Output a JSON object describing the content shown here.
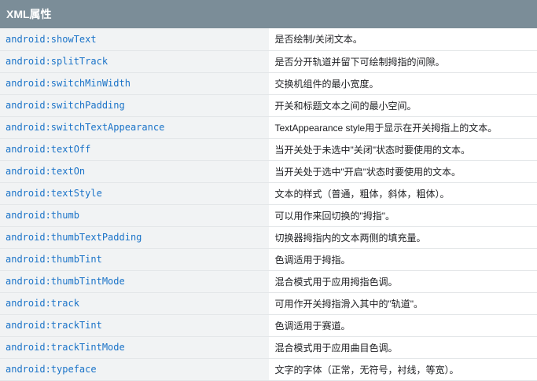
{
  "table": {
    "header": "XML属性",
    "rows": [
      {
        "attr": "android:showText",
        "desc": "是否绘制/关闭文本。"
      },
      {
        "attr": "android:splitTrack",
        "desc": "是否分开轨道并留下可绘制拇指的间隙。"
      },
      {
        "attr": "android:switchMinWidth",
        "desc": "交换机组件的最小宽度。"
      },
      {
        "attr": "android:switchPadding",
        "desc": "开关和标题文本之间的最小空间。"
      },
      {
        "attr": "android:switchTextAppearance",
        "desc": "TextAppearance style用于显示在开关拇指上的文本。"
      },
      {
        "attr": "android:textOff",
        "desc": "当开关处于未选中\"关闭\"状态时要使用的文本。"
      },
      {
        "attr": "android:textOn",
        "desc": "当开关处于选中\"开启\"状态时要使用的文本。"
      },
      {
        "attr": "android:textStyle",
        "desc": "文本的样式（普通，粗体，斜体，粗体）。"
      },
      {
        "attr": "android:thumb",
        "desc": "可以用作来回切换的\"拇指\"。"
      },
      {
        "attr": "android:thumbTextPadding",
        "desc": "切换器拇指内的文本两侧的填充量。"
      },
      {
        "attr": "android:thumbTint",
        "desc": "色调适用于拇指。"
      },
      {
        "attr": "android:thumbTintMode",
        "desc": "混合模式用于应用拇指色调。"
      },
      {
        "attr": "android:track",
        "desc": "可用作开关拇指滑入其中的\"轨道\"。"
      },
      {
        "attr": "android:trackTint",
        "desc": "色调适用于赛道。"
      },
      {
        "attr": "android:trackTintMode",
        "desc": "混合模式用于应用曲目色调。"
      },
      {
        "attr": "android:typeface",
        "desc": "文字的字体（正常，无符号，衬线，等宽）。"
      }
    ]
  }
}
